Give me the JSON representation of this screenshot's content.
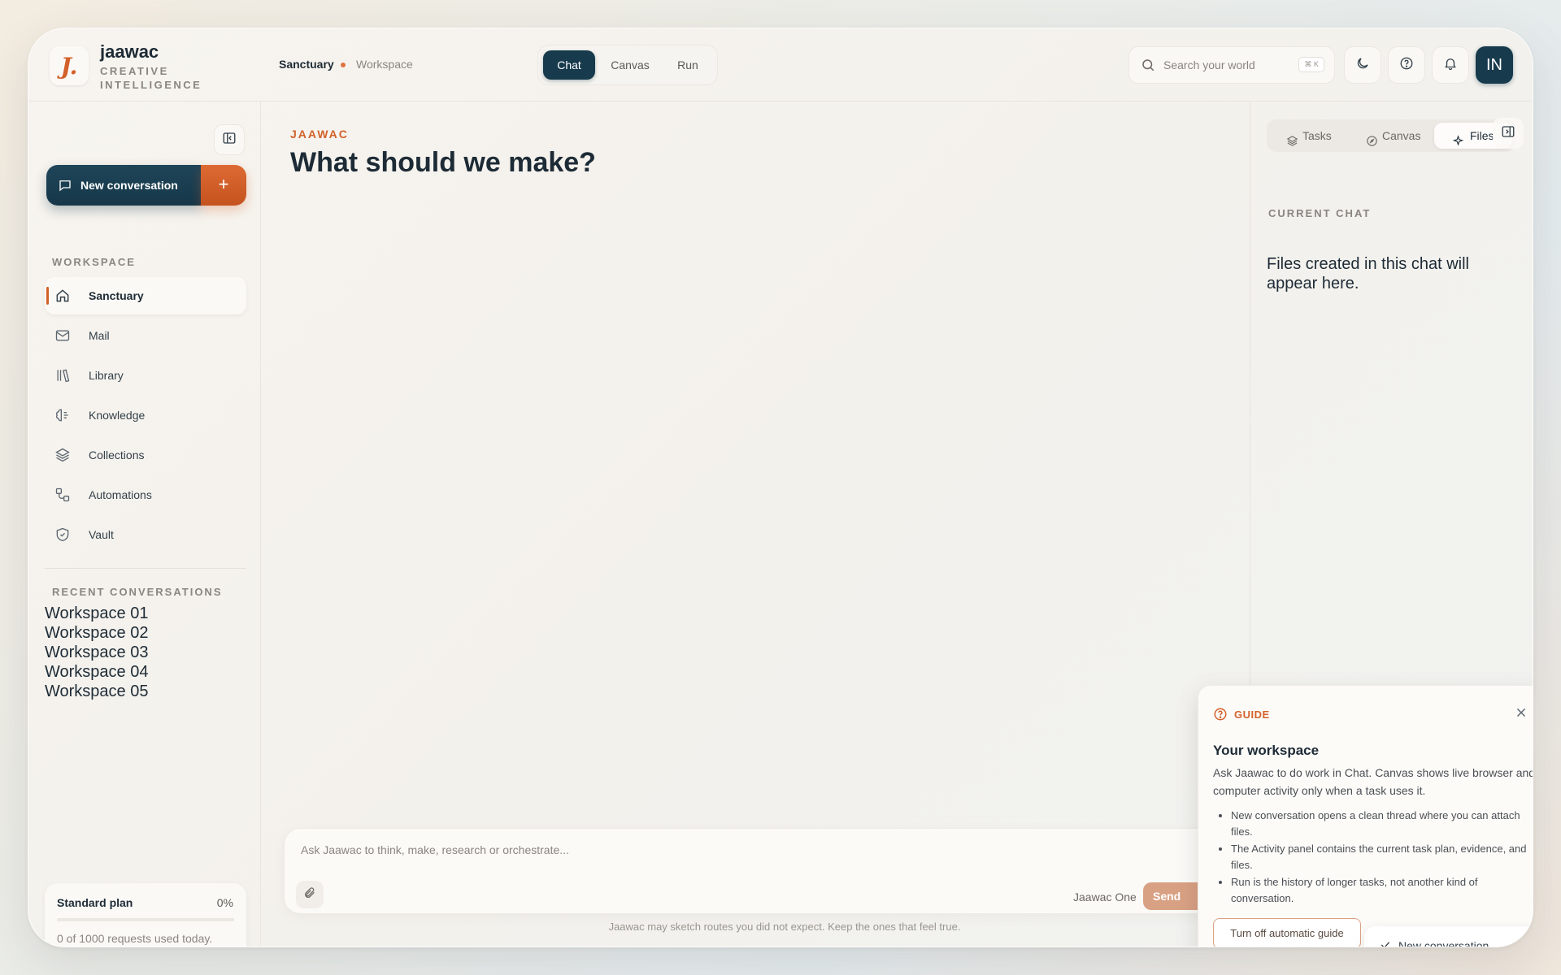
{
  "brand": {
    "logo_glyph": "J.",
    "name": "jaawac",
    "tagline": "CREATIVE INTELLIGENCE"
  },
  "breadcrumb": {
    "current": "Sanctuary",
    "context": "Workspace"
  },
  "mode_tabs": [
    {
      "label": "Chat",
      "active": true
    },
    {
      "label": "Canvas",
      "active": false
    },
    {
      "label": "Run",
      "active": false
    }
  ],
  "search": {
    "placeholder": "Search your world",
    "shortcut": "⌘ K"
  },
  "header_buttons": {
    "theme_icon": "moon-icon",
    "help_icon": "help-circle-icon",
    "notifications_icon": "bell-icon"
  },
  "user": {
    "initials": "IN"
  },
  "sidebar": {
    "new_conversation_label": "New conversation",
    "new_plus": "+",
    "workspace_title": "WORKSPACE",
    "items": [
      {
        "label": "Sanctuary",
        "icon": "home-icon",
        "active": true
      },
      {
        "label": "Mail",
        "icon": "mail-icon",
        "active": false
      },
      {
        "label": "Library",
        "icon": "library-icon",
        "active": false
      },
      {
        "label": "Knowledge",
        "icon": "brain-icon",
        "active": false
      },
      {
        "label": "Collections",
        "icon": "layers-icon",
        "active": false
      },
      {
        "label": "Automations",
        "icon": "workflow-icon",
        "active": false
      },
      {
        "label": "Vault",
        "icon": "shield-icon",
        "active": false
      }
    ],
    "recent_title": "RECENT CONVERSATIONS",
    "recent": [
      "Workspace 01",
      "Workspace 02",
      "Workspace 03",
      "Workspace 04",
      "Workspace 05"
    ],
    "plan": {
      "name": "Standard plan",
      "percent_label": "0%",
      "percent": 0,
      "usage": "0 of 1000 requests used today."
    }
  },
  "main": {
    "eyebrow": "JAAWAC",
    "headline": "What should we make?",
    "composer_placeholder": "Ask Jaawac to think, make, research or orchestrate...",
    "model": "Jaawac One",
    "send_label": "Send",
    "footer_note": "Jaawac may sketch routes you did not expect. Keep the ones that feel true."
  },
  "right_panel": {
    "tabs": [
      {
        "label": "Tasks",
        "icon": "layers-icon",
        "active": false
      },
      {
        "label": "Canvas",
        "icon": "compass-icon",
        "active": false
      },
      {
        "label": "Files",
        "icon": "sparkle-icon",
        "active": true
      }
    ],
    "section_title": "CURRENT CHAT",
    "empty_text": "Files created in this chat will appear here."
  },
  "guide": {
    "label": "GUIDE",
    "title": "Your workspace",
    "body": "Ask Jaawac to do work in Chat. Canvas shows live browser and computer activity only when a task uses it.",
    "bullets": [
      "New conversation opens a clean thread where you can attach files.",
      "The Activity panel contains the current task plan, evidence, and files.",
      "Run is the history of longer tasks, not another kind of conversation."
    ],
    "turn_off_label": "Turn off automatic guide",
    "toast_label": "New conversation"
  },
  "colors": {
    "accent": "#d2612a",
    "primary": "#173a4d",
    "background": "#f3f1ec"
  }
}
